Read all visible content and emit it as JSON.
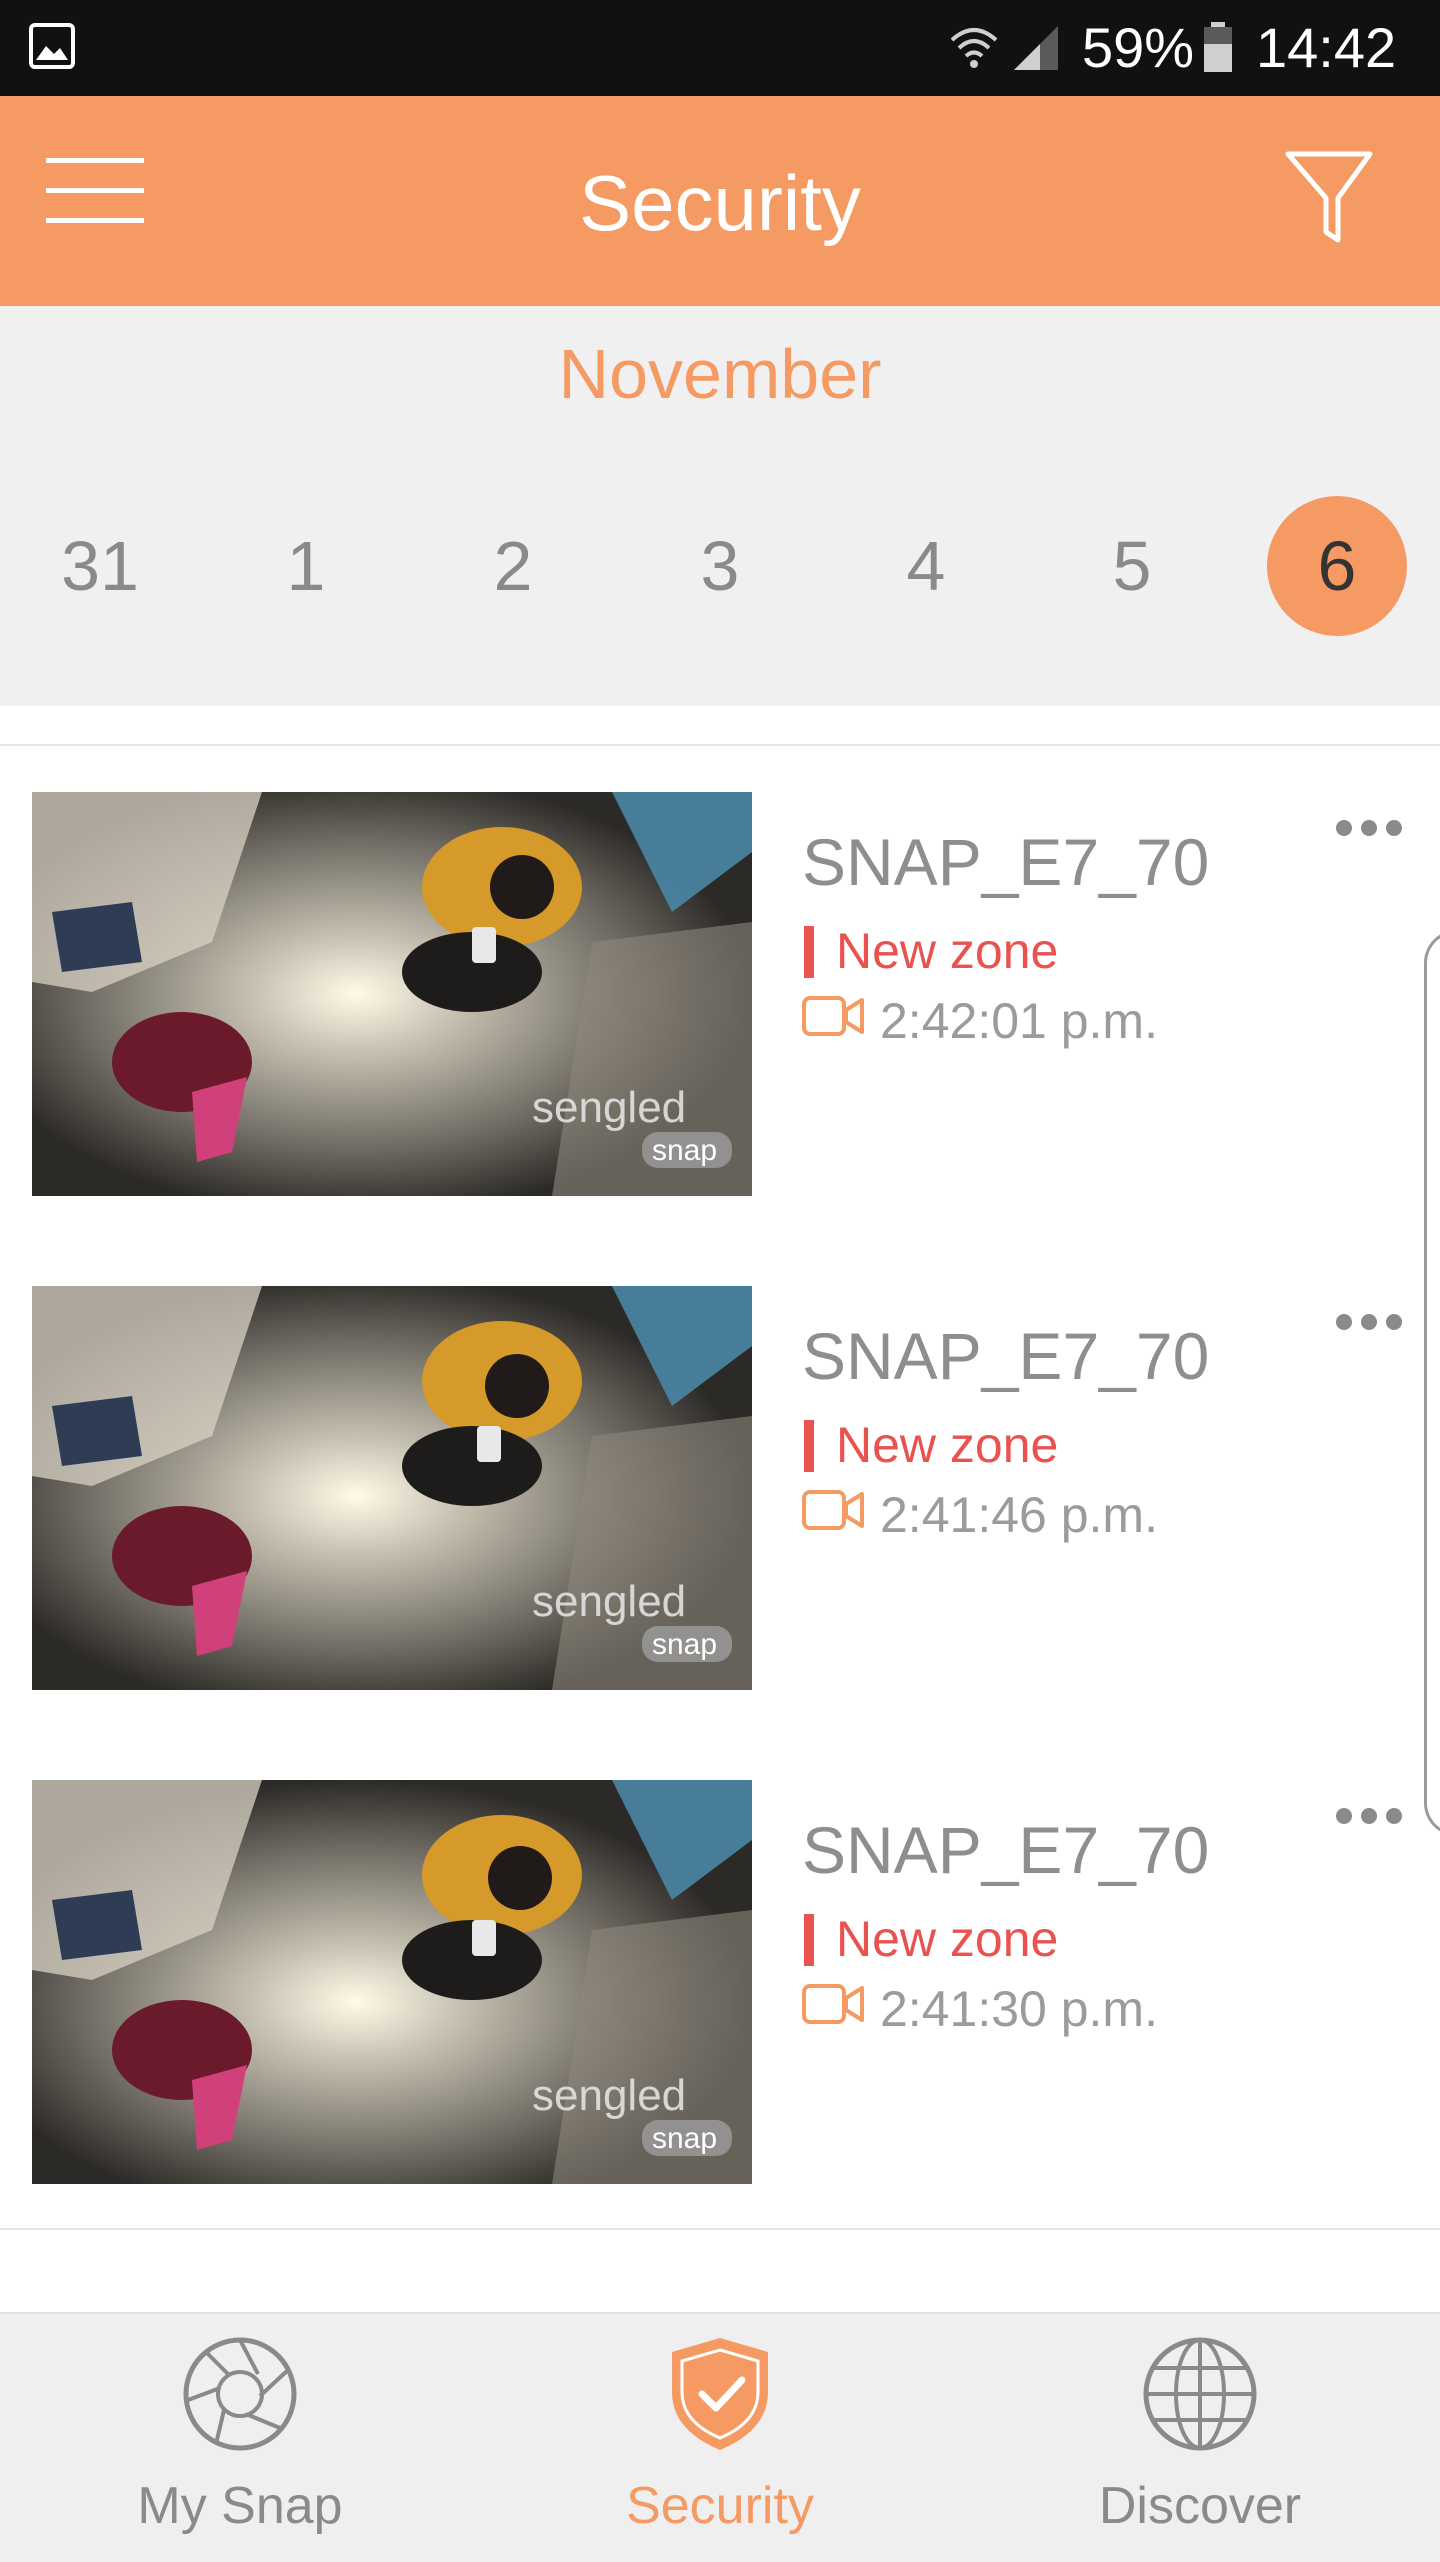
{
  "status_bar": {
    "battery": "59%",
    "time": "14:42",
    "icons": [
      "gallery-icon",
      "wifi-icon",
      "signal-icon",
      "battery-icon"
    ]
  },
  "app_bar": {
    "title": "Security",
    "menu_icon": "hamburger-menu-icon",
    "filter_icon": "filter-icon"
  },
  "calendar": {
    "month": "November",
    "days": [
      "31",
      "1",
      "2",
      "3",
      "4",
      "5",
      "6"
    ],
    "selected_day": "6"
  },
  "events": [
    {
      "device": "SNAP_E7_70",
      "zone": "New zone",
      "time": "2:42:01 p.m."
    },
    {
      "device": "SNAP_E7_70",
      "zone": "New zone",
      "time": "2:41:46 p.m."
    },
    {
      "device": "SNAP_E7_70",
      "zone": "New zone",
      "time": "2:41:30 p.m."
    }
  ],
  "thumbnail_watermark": {
    "brand": "sengled",
    "product": "snap"
  },
  "bottom_nav": {
    "items": [
      {
        "label": "My Snap",
        "icon": "aperture-icon"
      },
      {
        "label": "Security",
        "icon": "shield-check-icon"
      },
      {
        "label": "Discover",
        "icon": "globe-icon"
      }
    ],
    "active": "Security"
  },
  "colors": {
    "accent": "#F49A62",
    "zone": "#E8534F",
    "text_muted": "#8E8E8E",
    "strip_bg": "#F0F0F0"
  }
}
